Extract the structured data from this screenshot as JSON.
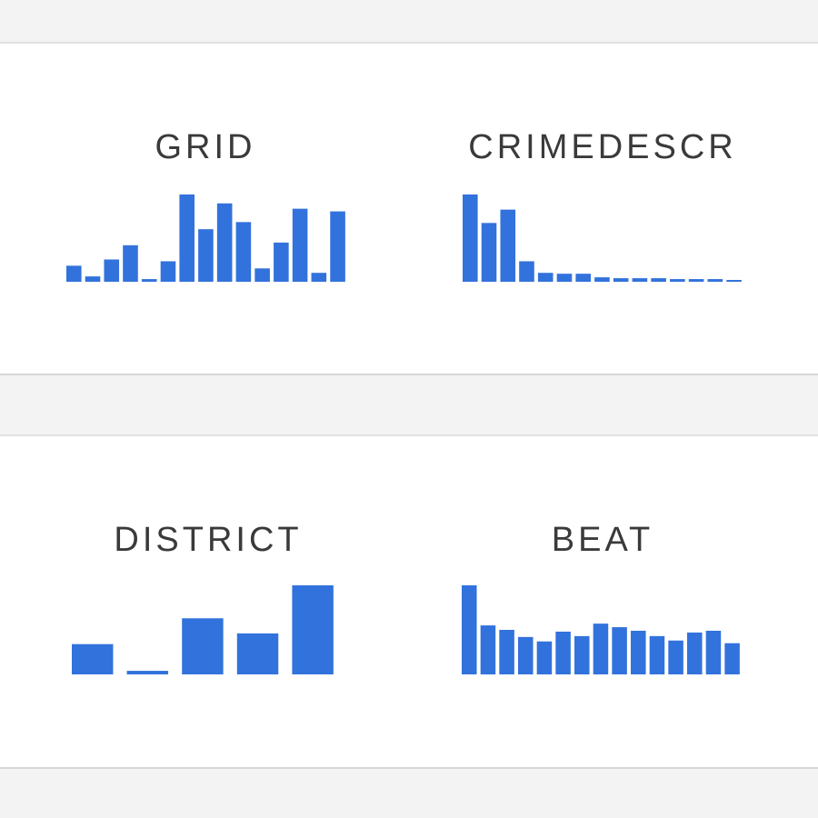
{
  "accent_color": "#3272dc",
  "panels": [
    {
      "id": "top",
      "columns": [
        {
          "title": "GRID",
          "chart_data": {
            "type": "bar",
            "values": [
              18,
              6,
              25,
              41,
              3,
              23,
              98,
              59,
              88,
              67,
              15,
              44,
              82,
              10,
              79
            ],
            "ylim": [
              0,
              100
            ]
          }
        },
        {
          "title": "CRIMEDESCR",
          "chart_data": {
            "type": "bar",
            "values": [
              98,
              66,
              81,
              23,
              10,
              9,
              9,
              5,
              4,
              4,
              4,
              3,
              3,
              3,
              2
            ],
            "ylim": [
              0,
              100
            ]
          }
        }
      ]
    },
    {
      "id": "bottom",
      "columns": [
        {
          "title": "DISTRICT",
          "chart_data": {
            "type": "bar",
            "values": [
              34,
              4,
              63,
              46,
              100
            ],
            "ylim": [
              0,
              100
            ]
          }
        },
        {
          "title": "BEAT",
          "chart_data": {
            "type": "bar",
            "values": [
              100,
              55,
              50,
              42,
              37,
              48,
              43,
              57,
              53,
              49,
              43,
              38,
              47,
              49,
              35
            ],
            "ylim": [
              0,
              100
            ]
          }
        }
      ]
    }
  ]
}
